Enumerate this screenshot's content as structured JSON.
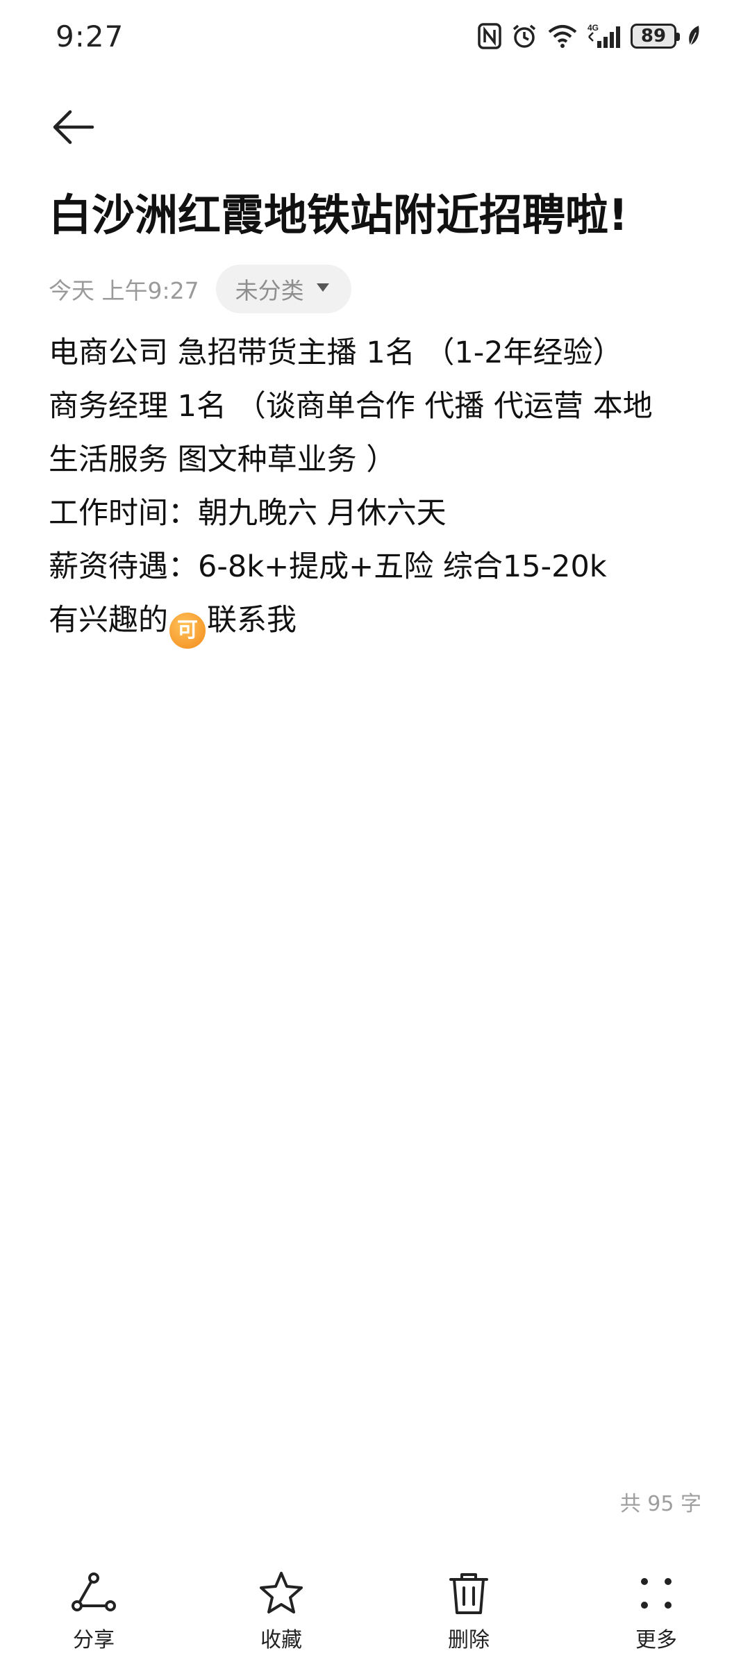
{
  "status_bar": {
    "time": "9:27",
    "battery": "89",
    "network": "4G"
  },
  "icons": {
    "back": "arrow-left-icon",
    "share": "share-icon",
    "favorite": "star-icon",
    "delete": "trash-icon",
    "more": "four-dots-icon",
    "category_dropdown": "caret-down-icon"
  },
  "note": {
    "title": "白沙洲红霞地铁站附近招聘啦!",
    "date": "今天 上午9:27",
    "category": "未分类",
    "lines": [
      "电商公司 急招带货主播 1名 （1-2年经验）",
      "商务经理 1名 （谈商单合作 代播 代运营 本地",
      "生活服务 图文种草业务 ）",
      "工作时间：朝九晚六 月休六天",
      "薪资待遇：6-8k+提成+五险 综合15-20k"
    ],
    "last_line_prefix": "有兴趣的",
    "emoji_char": "可",
    "last_line_suffix": "联系我",
    "word_count": "共 95 字"
  },
  "toolbar": {
    "share_label": "分享",
    "favorite_label": "收藏",
    "delete_label": "删除",
    "more_label": "更多"
  },
  "colors": {
    "emoji_orange": "#f38a1a",
    "chip_background": "#f1f1f1",
    "muted_text": "#9a9a9a"
  }
}
